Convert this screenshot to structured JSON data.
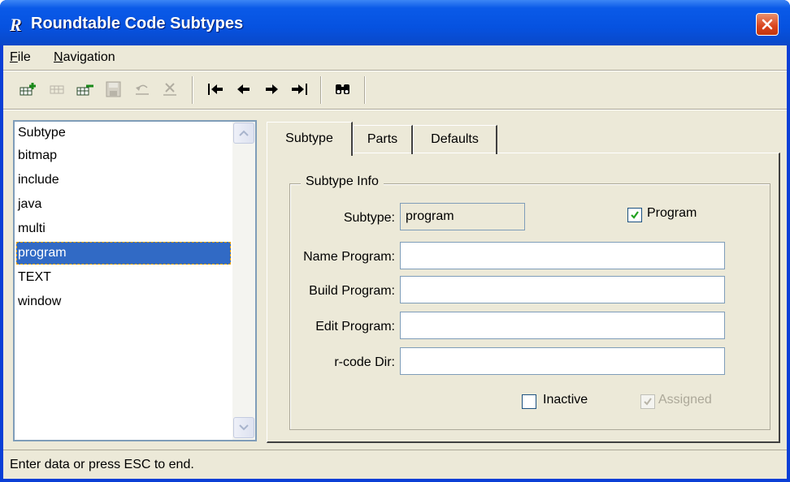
{
  "window": {
    "title": "Roundtable Code Subtypes",
    "app_icon_letter": "R"
  },
  "menu": [
    {
      "label": "File",
      "mnemonic": "F",
      "rest": "ile"
    },
    {
      "label": "Navigation",
      "mnemonic": "N",
      "rest": "avigation"
    }
  ],
  "toolbar": {
    "buttons": [
      {
        "icon": "add-record-icon",
        "enabled": true
      },
      {
        "icon": "copy-record-icon",
        "enabled": false
      },
      {
        "icon": "delete-record-icon",
        "enabled": true
      },
      {
        "icon": "save-icon",
        "enabled": false
      },
      {
        "icon": "undo-icon",
        "enabled": false
      },
      {
        "icon": "cancel-icon",
        "enabled": false
      },
      {
        "icon": "first-record-icon",
        "enabled": true
      },
      {
        "icon": "prev-record-icon",
        "enabled": true
      },
      {
        "icon": "next-record-icon",
        "enabled": true
      },
      {
        "icon": "last-record-icon",
        "enabled": true
      },
      {
        "icon": "binoculars-find-icon",
        "enabled": true
      }
    ]
  },
  "subtype_list": {
    "header": "Subtype",
    "items": [
      "bitmap",
      "include",
      "java",
      "multi",
      "program",
      "TEXT",
      "window"
    ],
    "selected": "program"
  },
  "tabs": {
    "labels": [
      "Subtype",
      "Parts",
      "Defaults"
    ],
    "active": "Subtype"
  },
  "subtype_info": {
    "group_title": "Subtype Info",
    "subtype_label": "Subtype:",
    "subtype_value": "program",
    "program_checkbox_label": "Program",
    "program_checked": true,
    "name_program_label": "Name Program:",
    "name_program_value": "",
    "build_program_label": "Build Program:",
    "build_program_value": "",
    "edit_program_label": "Edit Program:",
    "edit_program_value": "",
    "rcode_dir_label": "r-code Dir:",
    "rcode_dir_value": "",
    "inactive_label": "Inactive",
    "inactive_checked": false,
    "assigned_label": "Assigned",
    "assigned_checked": true,
    "assigned_enabled": false
  },
  "status": {
    "text": "Enter data or press ESC to end."
  },
  "colors": {
    "title_bar": "#0a5ae8",
    "selection": "#316ac5",
    "close_button": "#d9431c",
    "dialog_face": "#ece9d8"
  }
}
